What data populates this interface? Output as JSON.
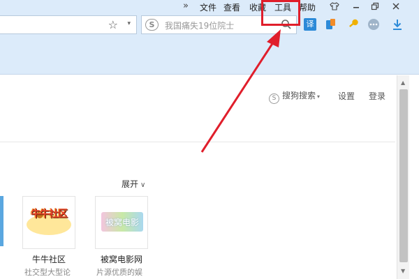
{
  "menu": {
    "overflow": "»",
    "file": "文件",
    "view": "查看",
    "favorites": "收藏",
    "tools": "工具",
    "help": "帮助"
  },
  "toolbar": {
    "star_glyph": "☆",
    "dropdown_glyph": "▾",
    "search_logo": "S",
    "search_placeholder": "我国痛失19位院士",
    "translate_label": "译"
  },
  "page": {
    "sogou_logo": "S",
    "sogou_search": "搜狗搜索",
    "caret": "▾",
    "settings": "设置",
    "login": "登录",
    "expand": "展开",
    "expand_chev": "∨"
  },
  "tiles": [
    {
      "name": "牛牛社区",
      "desc": "社交型大型论",
      "logo_text": "牛牛社区"
    },
    {
      "name": "被窝电影网",
      "desc": "片源优质的娱",
      "logo_text": "被窝电影"
    }
  ],
  "scrollbar": {
    "up": "▲",
    "down": "▼"
  },
  "colors": {
    "chrome": "#dcebfa",
    "annotation": "#e01e2b",
    "accent_blue": "#2c8ad8",
    "key_gold": "#f0b000"
  }
}
